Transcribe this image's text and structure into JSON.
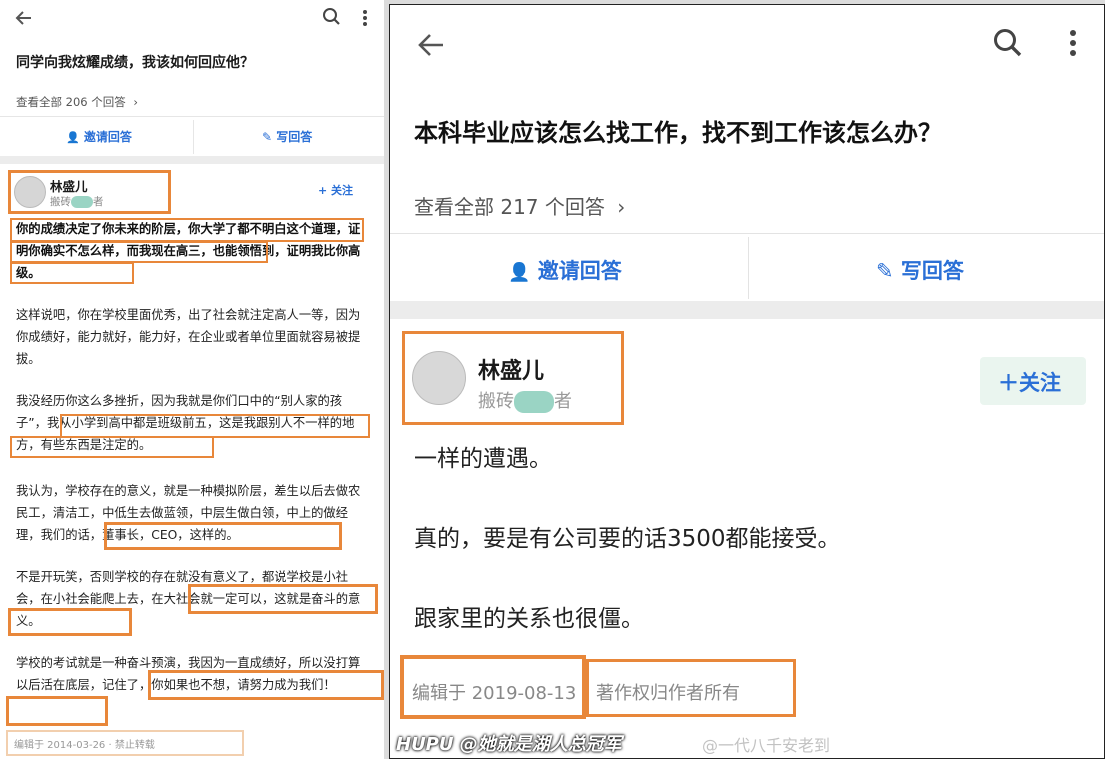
{
  "left": {
    "question_title": "同学向我炫耀成绩，我该如何回应他？",
    "view_all": "查看全部 206 个回答",
    "invite_label": "邀请回答",
    "write_label": "写回答",
    "author_name": "林盛儿",
    "author_desc_prefix": "搬砖",
    "author_desc_suffix": "者",
    "follow_label": "+ 关注",
    "paragraphs": [
      "你的成绩决定了你未来的阶层，你大学了都不明白这个道理，证明你确实不怎么样，而我现在高三，也能领悟到，证明我比你高级。",
      "这样说吧，你在学校里面优秀，出了社会就注定高人一等，因为你成绩好，能力就好，能力好，在企业或者单位里面就容易被提拔。",
      "我没经历你这么多挫折，因为我就是你们口中的“别人家的孩子”，我从小学到高中都是班级前五，这是我跟别人不一样的地方，有些东西是注定的。",
      "我认为，学校存在的意义，就是一种模拟阶层，差生以后去做农民工，清洁工，中低生去做蓝领，中层生做白领，中上的做经理，我们的话，董事长，CEO，这样的。",
      "不是开玩笑，否则学校的存在就没有意义了，都说学校是小社会，在小社会能爬上去，在大社会就一定可以，这就是奋斗的意义。",
      "学校的考试就是一种奋斗预演，我因为一直成绩好，所以没打算以后活在底层，记住了，你如果也不想，请努力成为我们！"
    ],
    "footer": "编辑于 2014-03-26 · 禁止转载"
  },
  "right": {
    "question_title": "本科毕业应该怎么找工作，找不到工作该怎么办？",
    "view_all": "查看全部 217 个回答",
    "invite_label": "邀请回答",
    "write_label": "写回答",
    "author_name": "林盛儿",
    "author_desc_prefix": "搬砖",
    "author_desc_suffix": "者",
    "follow_label": "关注",
    "lines": [
      "一样的遭遇。",
      "真的，要是有公司要的话3500都能接受。",
      "跟家里的关系也很僵。"
    ],
    "edit_date": "编辑于 2019-08-13",
    "copyright": "著作权归作者所有"
  },
  "watermark": {
    "main": "HUPU @她就是湖人总冠军",
    "faint": "@一代八千安老到"
  },
  "colors": {
    "highlight": "#e8873a",
    "accent_blue": "#2a6fd6",
    "follow_green_bg": "#eaf5ef"
  },
  "icons": [
    "back-arrow-icon",
    "search-icon",
    "more-vert-icon",
    "invite-user-icon",
    "edit-icon",
    "chevron-right-icon",
    "avatar"
  ]
}
